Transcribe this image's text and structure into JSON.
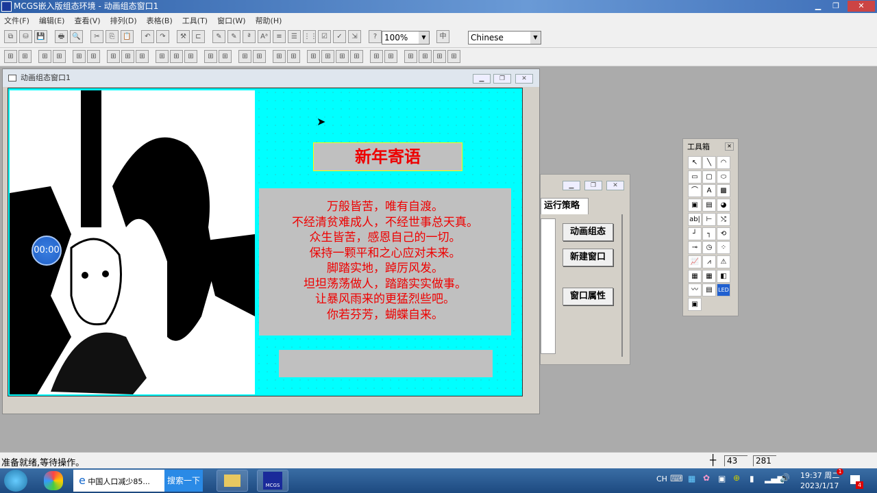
{
  "app": {
    "title": "MCGS嵌入版组态环境 - 动画组态窗口1"
  },
  "menu": [
    "文件(F)",
    "编辑(E)",
    "查看(V)",
    "排列(D)",
    "表格(B)",
    "工具(T)",
    "窗口(W)",
    "帮助(H)"
  ],
  "toolbar": {
    "zoom": "100%",
    "language": "Chinese"
  },
  "child_window": {
    "title": "动画组态窗口1"
  },
  "canvas": {
    "heading": "新年寄语",
    "poem": [
      "万般皆苦，唯有自渡。",
      "不经清贫难成人，不经世事总天真。",
      "众生皆苦，感恩自己的一切。",
      "保持一颗平和之心应对未来。",
      "脚踏实地，踔厉风发。",
      "坦坦荡荡做人，踏踏实实做事。",
      "让暴风雨来的更猛烈些吧。",
      "你若芬芳，蝴蝶自来。"
    ],
    "timer": "00:00",
    "bg_color": "#00ffff",
    "text_color": "#e00000"
  },
  "workspace": {
    "tab": "运行策略",
    "buttons": [
      "动画组态",
      "新建窗口",
      "窗口属性"
    ]
  },
  "toolbox": {
    "title": "工具箱",
    "tools": [
      "pointer",
      "line",
      "arc",
      "rectangle",
      "rounded-rect",
      "ellipse",
      "polyline",
      "label-A",
      "bitmap",
      "image",
      "blank",
      "palette",
      "input-box",
      "slider",
      "switch",
      "line2",
      "poly2",
      "curve",
      "button",
      "clock",
      "dots",
      "trend",
      "chart2",
      "alarm",
      "table",
      "table2",
      "3d",
      "curve2",
      "report",
      "LED",
      "scene"
    ]
  },
  "status": {
    "text": "准备就绪,等待操作。",
    "x": "43",
    "y": "281"
  },
  "taskbar": {
    "browser_item": "中国人口减少85...",
    "search": "搜索一下",
    "app": "MCGS",
    "lang": "CH",
    "time": "19:37 周二",
    "date": "2023/1/17",
    "badge_time": "1",
    "badge_notify": "4"
  }
}
